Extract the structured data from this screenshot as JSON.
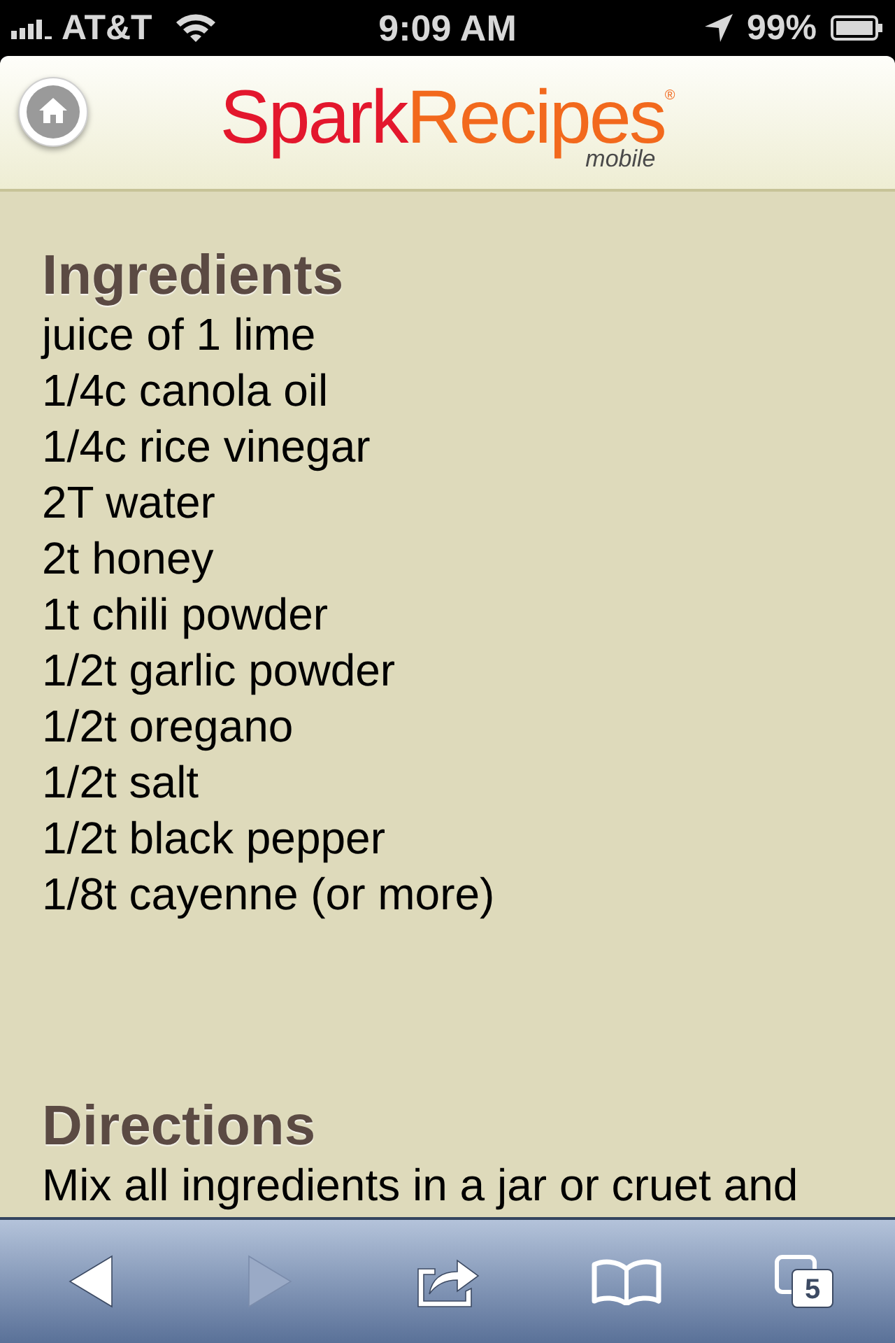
{
  "status_bar": {
    "carrier": "AT&T",
    "time": "9:09 AM",
    "battery": "99%"
  },
  "header": {
    "logo": {
      "part_1": "Spark",
      "part_2": "Recipes",
      "registered": "®",
      "subtitle": "mobile"
    }
  },
  "ingredients": {
    "heading": "Ingredients",
    "items": [
      "juice of 1 lime",
      "1/4c canola oil",
      "1/4c rice vinegar",
      "2T water",
      "2t honey",
      "1t chili powder",
      "1/2t garlic powder",
      "1/2t oregano",
      "1/2t salt",
      "1/2t black pepper",
      "1/8t cayenne (or more)"
    ]
  },
  "directions": {
    "heading": "Directions",
    "lines": [
      "Mix all ingredients in a jar or cruet and"
    ]
  },
  "toolbar": {
    "buttons": [
      {
        "kind": "back",
        "disabled": false
      },
      {
        "kind": "forward",
        "disabled": true
      },
      {
        "kind": "share",
        "disabled": false
      },
      {
        "kind": "bookmarks",
        "disabled": false
      },
      {
        "kind": "tabs",
        "disabled": false,
        "count": "5"
      }
    ]
  }
}
